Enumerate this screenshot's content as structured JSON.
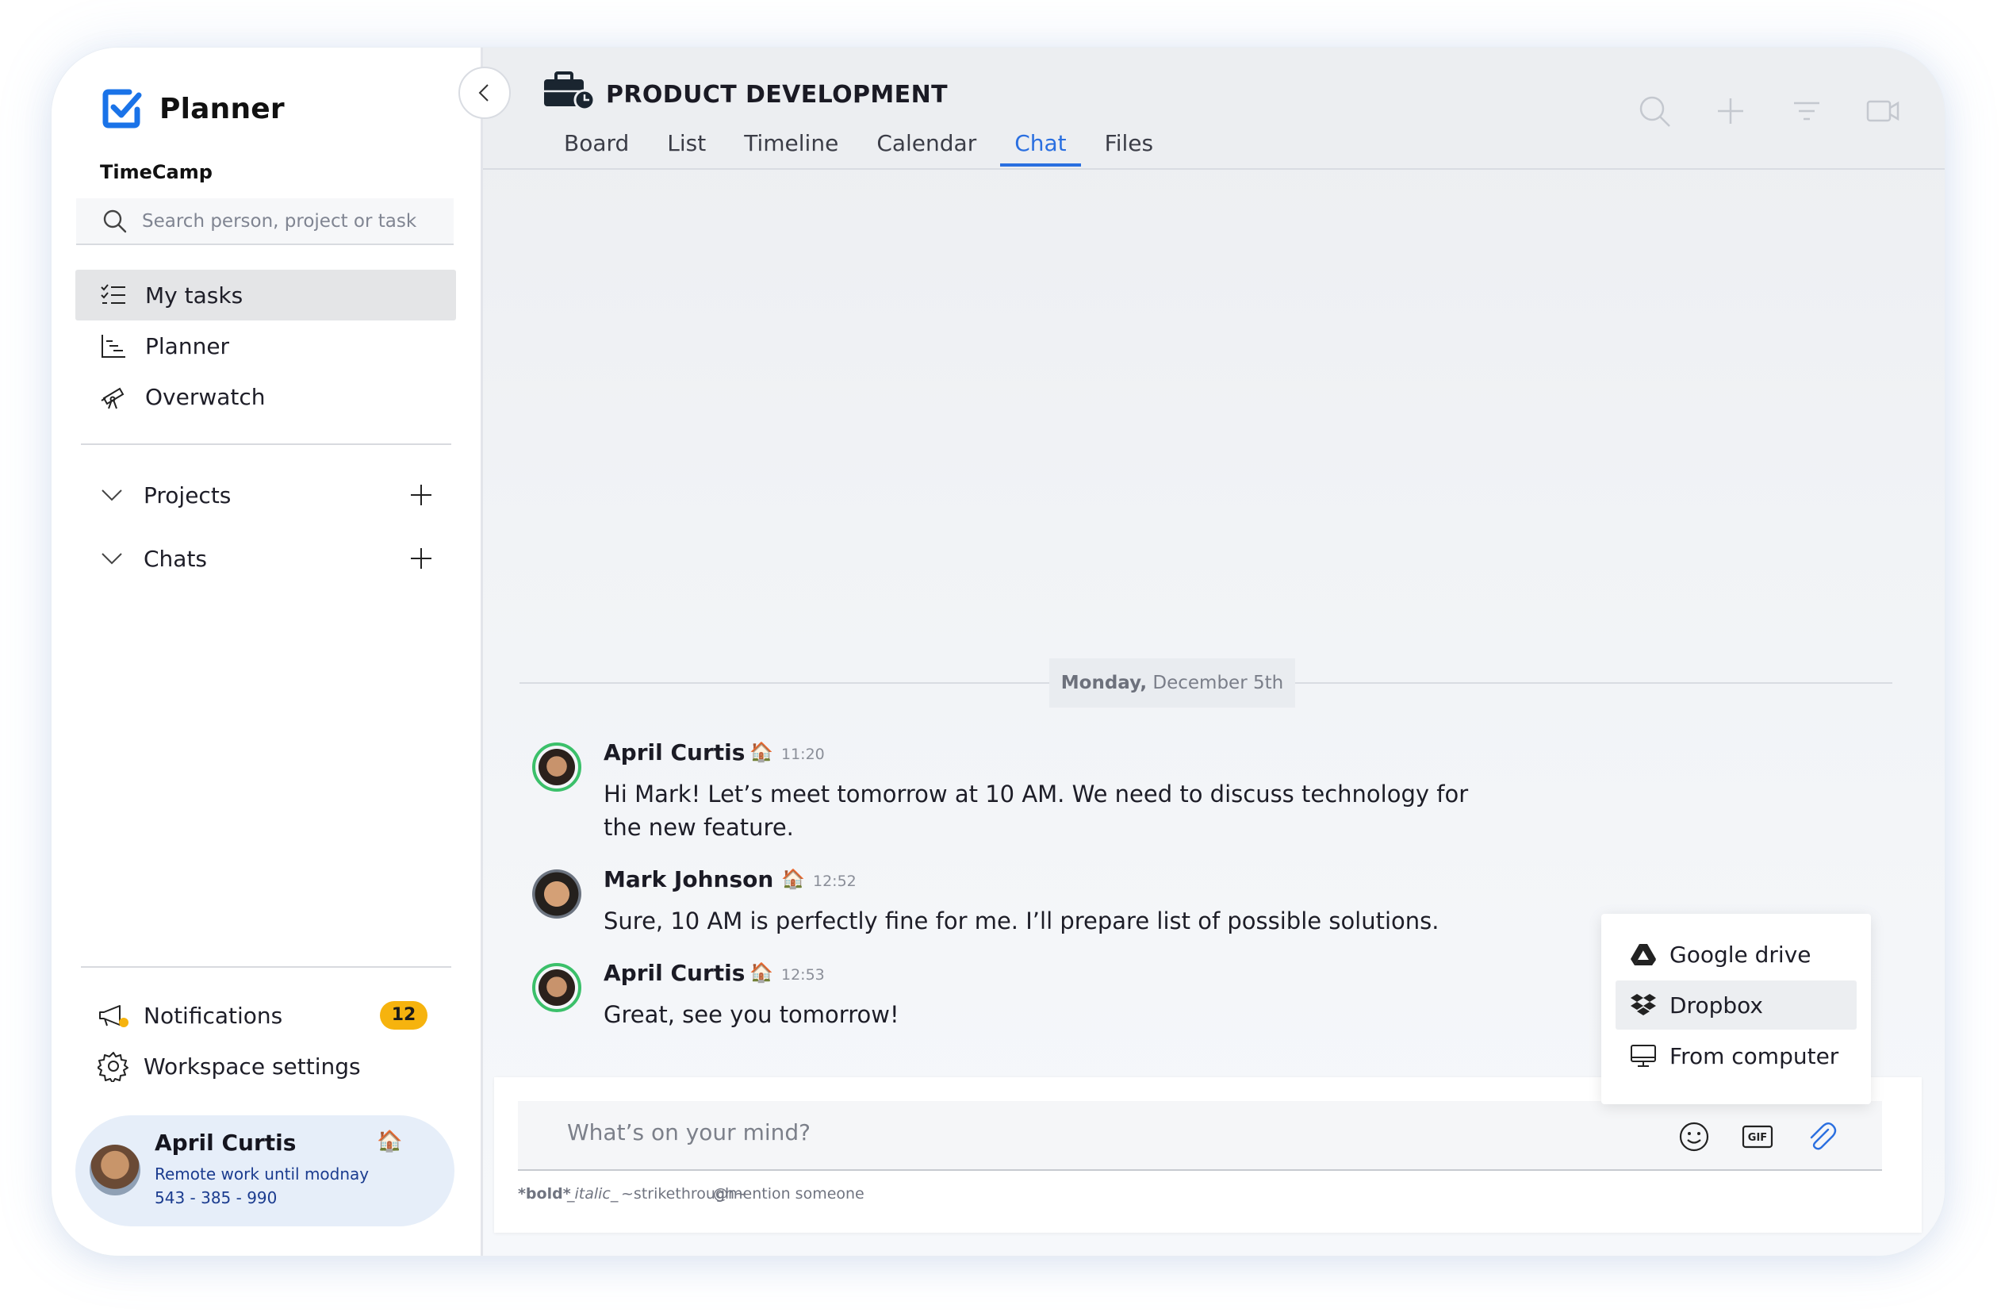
{
  "app": {
    "name": "Planner",
    "workspace": "TimeCamp"
  },
  "search": {
    "placeholder": "Search person, project or task"
  },
  "nav": [
    {
      "label": "My tasks",
      "icon": "task-list-icon"
    },
    {
      "label": "Planner",
      "icon": "chart-icon"
    },
    {
      "label": "Overwatch",
      "icon": "telescope-icon"
    }
  ],
  "sections": [
    {
      "label": "Projects"
    },
    {
      "label": "Chats"
    }
  ],
  "bottom": {
    "notifications_label": "Notifications",
    "notifications_count": "12",
    "settings_label": "Workspace settings"
  },
  "user": {
    "name": "April Curtis",
    "status": "Remote work until modnay",
    "phone": "543 - 385 - 990",
    "status_emoji": "🏠"
  },
  "project": {
    "title": "PRODUCT DEVELOPMENT",
    "tabs": [
      "Board",
      "List",
      "Timeline",
      "Calendar",
      "Chat",
      "Files"
    ],
    "active_tab": "Chat"
  },
  "chat": {
    "date_day": "Monday,",
    "date_rest": " December 5th",
    "messages": [
      {
        "author": "April Curtis",
        "emoji": "🏠",
        "time": "11:20",
        "text": "Hi Mark! Let’s meet tomorrow at 10 AM. We need to discuss technology for the new feature."
      },
      {
        "author": "Mark Johnson",
        "emoji": "🏠",
        "time": "12:52",
        "text": "Sure, 10 AM is perfectly fine for me. I’ll prepare list of possible solutions."
      },
      {
        "author": "April Curtis",
        "emoji": "🏠",
        "time": "12:53",
        "text": "Great, see you tomorrow!"
      }
    ]
  },
  "attach_menu": [
    {
      "label": "Google drive",
      "icon": "google-drive-icon"
    },
    {
      "label": "Dropbox",
      "icon": "dropbox-icon"
    },
    {
      "label": "From computer",
      "icon": "computer-icon"
    }
  ],
  "composer": {
    "placeholder": "What’s on your mind?",
    "hints": {
      "bold": "*bold*",
      "italic": "_italic_",
      "strike": "~strikethrough~",
      "mention": "@mention someone"
    }
  },
  "colors": {
    "accent": "#2a6fe0",
    "badge": "#f6b30e",
    "online": "#3bc06a"
  }
}
